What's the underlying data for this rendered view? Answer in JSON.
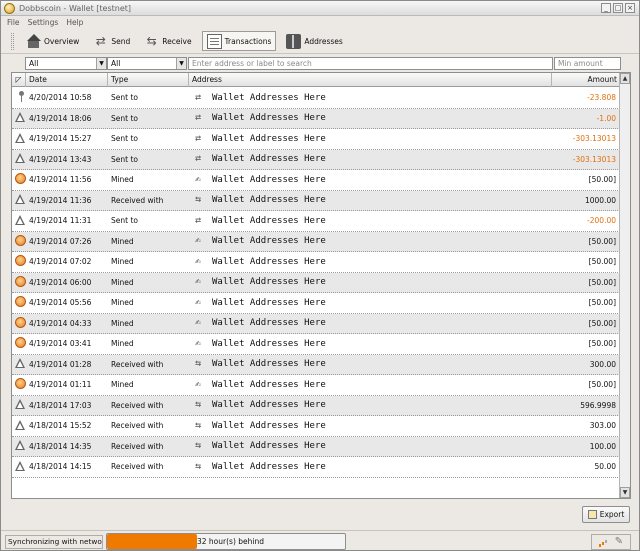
{
  "window": {
    "title": "Dobbscoin - Wallet [testnet]"
  },
  "menu": [
    "File",
    "Settings",
    "Help"
  ],
  "toolbar": [
    {
      "label": "Overview",
      "icon": "home-icon",
      "active": false
    },
    {
      "label": "Send",
      "icon": "send-arrows-icon",
      "active": false
    },
    {
      "label": "Receive",
      "icon": "receive-arrows-icon",
      "active": false
    },
    {
      "label": "Transactions",
      "icon": "transactions-icon",
      "active": true
    },
    {
      "label": "Addresses",
      "icon": "addressbook-icon",
      "active": false
    }
  ],
  "filters": {
    "date": "All",
    "type": "All",
    "search_placeholder": "Enter address or label to search",
    "min_amount_placeholder": "Min amount"
  },
  "table": {
    "columns": [
      "Date",
      "Type",
      "Address",
      "Amount"
    ],
    "rows": [
      {
        "status": "pin",
        "date": "4/20/2014 10:58",
        "type": "Sent to",
        "type_icon": "sent",
        "address": "Wallet Addresses Here",
        "amount": "-23.808",
        "negative": true
      },
      {
        "status": "tri",
        "date": "4/19/2014 18:06",
        "type": "Sent to",
        "type_icon": "sent",
        "address": "Wallet Addresses Here",
        "amount": "-1.00",
        "negative": true
      },
      {
        "status": "tri",
        "date": "4/19/2014 15:27",
        "type": "Sent to",
        "type_icon": "sent",
        "address": "Wallet Addresses Here",
        "amount": "-303.13013",
        "negative": true
      },
      {
        "status": "tri",
        "date": "4/19/2014 13:43",
        "type": "Sent to",
        "type_icon": "sent",
        "address": "Wallet Addresses Here",
        "amount": "-303.13013",
        "negative": true
      },
      {
        "status": "clock",
        "date": "4/19/2014 11:56",
        "type": "Mined",
        "type_icon": "mined",
        "address": "Wallet Addresses Here",
        "amount": "[50.00]",
        "negative": false
      },
      {
        "status": "tri",
        "date": "4/19/2014 11:36",
        "type": "Received with",
        "type_icon": "received",
        "address": "Wallet Addresses Here",
        "amount": "1000.00",
        "negative": false
      },
      {
        "status": "tri",
        "date": "4/19/2014 11:31",
        "type": "Sent to",
        "type_icon": "sent",
        "address": "Wallet Addresses Here",
        "amount": "-200.00",
        "negative": true
      },
      {
        "status": "clock",
        "date": "4/19/2014 07:26",
        "type": "Mined",
        "type_icon": "mined",
        "address": "Wallet Addresses Here",
        "amount": "[50.00]",
        "negative": false
      },
      {
        "status": "clock",
        "date": "4/19/2014 07:02",
        "type": "Mined",
        "type_icon": "mined",
        "address": "Wallet Addresses Here",
        "amount": "[50.00]",
        "negative": false
      },
      {
        "status": "clock",
        "date": "4/19/2014 06:00",
        "type": "Mined",
        "type_icon": "mined",
        "address": "Wallet Addresses Here",
        "amount": "[50.00]",
        "negative": false
      },
      {
        "status": "clock",
        "date": "4/19/2014 05:56",
        "type": "Mined",
        "type_icon": "mined",
        "address": "Wallet Addresses Here",
        "amount": "[50.00]",
        "negative": false
      },
      {
        "status": "clock",
        "date": "4/19/2014 04:33",
        "type": "Mined",
        "type_icon": "mined",
        "address": "Wallet Addresses Here",
        "amount": "[50.00]",
        "negative": false
      },
      {
        "status": "clock",
        "date": "4/19/2014 03:41",
        "type": "Mined",
        "type_icon": "mined",
        "address": "Wallet Addresses Here",
        "amount": "[50.00]",
        "negative": false
      },
      {
        "status": "tri",
        "date": "4/19/2014 01:28",
        "type": "Received with",
        "type_icon": "received",
        "address": "Wallet Addresses Here",
        "amount": "300.00",
        "negative": false
      },
      {
        "status": "clock",
        "date": "4/19/2014 01:11",
        "type": "Mined",
        "type_icon": "mined",
        "address": "Wallet Addresses Here",
        "amount": "[50.00]",
        "negative": false
      },
      {
        "status": "tri",
        "date": "4/18/2014 17:03",
        "type": "Received with",
        "type_icon": "received",
        "address": "Wallet Addresses Here",
        "amount": "596.9998",
        "negative": false
      },
      {
        "status": "tri",
        "date": "4/18/2014 15:52",
        "type": "Received with",
        "type_icon": "received",
        "address": "Wallet Addresses Here",
        "amount": "303.00",
        "negative": false
      },
      {
        "status": "tri",
        "date": "4/18/2014 14:35",
        "type": "Received with",
        "type_icon": "received",
        "address": "Wallet Addresses Here",
        "amount": "100.00",
        "negative": false
      },
      {
        "status": "tri",
        "date": "4/18/2014 14:15",
        "type": "Received with",
        "type_icon": "received",
        "address": "Wallet Addresses Here",
        "amount": "50.00",
        "negative": false
      }
    ]
  },
  "export_label": "Export",
  "status": {
    "sync_label": "Synchronizing with network...",
    "progress_fraction": 0.38,
    "progress_text": "32 hour(s) behind"
  },
  "colors": {
    "negative_amount": "#e07010",
    "progress": "#f07a00"
  }
}
